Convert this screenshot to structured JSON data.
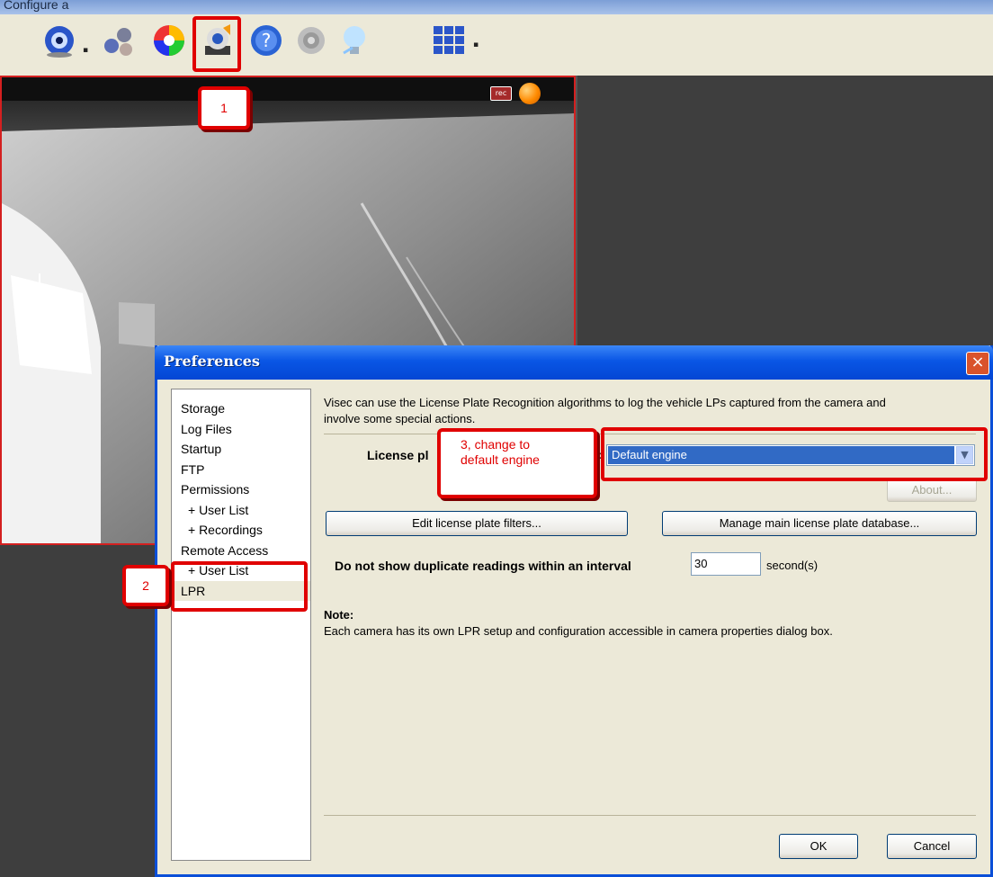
{
  "window": {
    "title_fragment": "Configure a"
  },
  "toolbar": {
    "icons": [
      "camera-icon",
      "cameras-group-icon",
      "color-palette-icon",
      "preferences-icon",
      "help-icon",
      "speaker-icon",
      "lightbulb-icon",
      "layout-grid-icon"
    ]
  },
  "video": {
    "rec_label": "rec"
  },
  "callouts": {
    "step1": "1",
    "step2": "2",
    "step3_line1": "3, change to",
    "step3_line2": "default engine"
  },
  "dialog": {
    "title": "Preferences",
    "close": "×",
    "nav": [
      {
        "label": "Storage"
      },
      {
        "label": "Log Files"
      },
      {
        "label": "Startup"
      },
      {
        "label": "FTP"
      },
      {
        "label": "Permissions"
      },
      {
        "label": "+ User List"
      },
      {
        "label": "+ Recordings"
      },
      {
        "label": "Remote Access"
      },
      {
        "label": "+ User List"
      },
      {
        "label": "LPR"
      }
    ],
    "selected_nav": "LPR",
    "description_line1": "Visec can use the License Plate Recognition algorithms to log the vehicle LPs captured from the camera and",
    "description_line2": "involve some special actions.",
    "engine_label": "License pl",
    "engine_label_suffix": ":",
    "engine_value": "Default engine",
    "about_button": "About...",
    "filters_button": "Edit license plate filters...",
    "database_button": "Manage main license plate database...",
    "interval_label": "Do not show duplicate readings within an interval",
    "interval_value": "30",
    "interval_unit": "second(s)",
    "note_title": "Note:",
    "note_text": "Each camera has its own LPR setup and configuration accessible in camera properties dialog box.",
    "ok_button": "OK",
    "cancel_button": "Cancel"
  },
  "colors": {
    "highlight_red": "#e00000",
    "titlebar_blue": "#0a56e5",
    "selection_blue": "#316ac5"
  }
}
